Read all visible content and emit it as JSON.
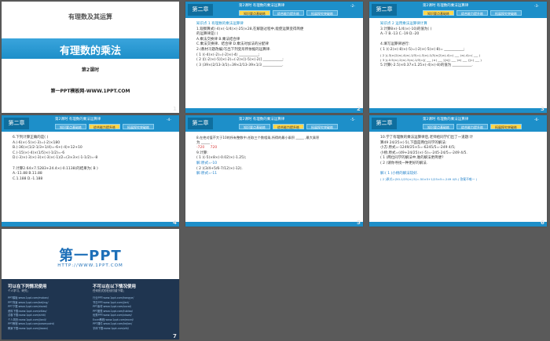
{
  "slides": {
    "s1": {
      "course": "有理数及其运算",
      "title": "有理数的乘法",
      "lesson": "第2课时",
      "footer": "第一PPT模板网-WWW.1PPT.COM",
      "num": "1"
    },
    "header": {
      "chapter": "第二章",
      "subtitle": "第2课时  有理数的乘法运算律",
      "tab1": "知识要点基础练",
      "tab2": "综合能力提升练",
      "tab3": "拓展探究突破练"
    },
    "s2": {
      "page": "-2-",
      "num": "2",
      "lines": [
        "知识点 1   有理数的乘法运算律",
        "1.观察算式(-4)×(-1/4)×(-25)×28,在解题过程中,能使运算变得简便",
        "的运算律是(      )",
        "A.乘法交换律                    B.乘法结合律",
        "C.乘法交换律、结合律        D.乘法对加法的分配律",
        "2.(教材习题改编)写出下列变形所依据的运算律.",
        "( 1 )(-4)×(-2)=(-2)×(-4) ___________;",
        "( 2 )[(-2)×(-5)]×(-2)=(-2)×[(-5)×(-2)] ___________;",
        "( 3 )39×(2/13-3/1)=39×2/13-39×1/3 ___________."
      ]
    },
    "s3": {
      "page": "-3-",
      "num": "3",
      "lines": [
        "知识点 2   运用乘法运算律计算",
        "3.计算8×(-1/4)×(-10)的值为(    )",
        "A.-7           B.-13           C.-19           D.-20",
        "",
        "4.填写运算律进行:",
        "( 1 )(-2)×(-8)×(-5)=(-2)×(-5)×(-8)= ___________;",
        "( 2 )(-3)×(2)×(-4)×(-1/3)=(-3)×(-1/3)×(2)×(-4)=( ___ )×(-4)=( ___ )",
        "( 3 )(-0.5)×(-2)×(-3)×(-1/3)=[( ___ )×( ___ )]×[( ___ )×( ___ )]=( ___ )",
        "5.计算(-2.5)×0.37×1.25×(-4)×(-8)的值为 ___________."
      ]
    },
    "s4": {
      "page": "-4-",
      "num": "4",
      "lines": [
        "6.下列计算正确的是(     )",
        "A.(-6)×(-5)×(-3)=(-2)×180",
        "B.(-36)×(1/2-1/3+1/4)=-6+(-4)+12+10",
        "C.(-15)×(-4)×(1/5)×(-1/2)=-6",
        "D.(-3)×(-3)×(-3)×(-3)×(-1)/2=(3×3×(-1-1/2)=-8",
        "",
        "7.计算2.64×7.5283+24.4×(-0.1138)的结果为(  B  )",
        "A.-11.88                    B.11.88",
        "C.1.188                     D.-1.188"
      ]
    },
    "s5": {
      "page": "-5-",
      "num": "5",
      "lines": [
        "8.在绝对值不大于10的所有整数中,任取三个数相乘,所得的最小乘积 _____ ,最大乘积",
        "为 _____ .",
        "9.计算:",
        "( 1 )(-5)×8×(-0.02)×(-1.25);",
        "解:原式=-10",
        "( 2 )(3/4+5/6-7/12)×(-12).",
        "解:原式=-11"
      ],
      "answers": [
        "-720",
        "720"
      ]
    },
    "s6": {
      "page": "-6-",
      "num": "6",
      "lines": [
        "10.学了有理数的乘法运算律后,老师给同学们出了一道题:计",
        "算49 24/25×(-5),下面是两位同学的解法:",
        "小方:原式=-1249/25×5=-6245/5=-249 4/5;",
        "小杨:原式=(49+24/25)×(-5)=-245-24/5=-249 4/5.",
        "( 1 )两位同学的解法中,谁的解法更简便?",
        "( 2 )请你寻找一种更好的解法.",
        "",
        "解:( 1 )小杨的解法较好.",
        "( 2 )原式=(50-1/25)×(-5)=-50×5+1/25×5=-249 4/5.( 答案不唯一 )"
      ]
    },
    "s7": {
      "logo": "第一PPT",
      "url": "HTTP://WWW.1PPT.COM",
      "num": "7",
      "can_title": "可以在下列情况使用",
      "can_sub": "个人学习、研究；",
      "cannot_title": "不可以在以下情况使用",
      "cannot_sub": "任何形式的在线付费下载；",
      "links_left": [
        "PPT模板:www.1ppt.com/moban/",
        "PPT背景:www.1ppt.com/beijing/",
        "PPT下载:www.1ppt.com/xiazai/",
        "资料下载:www.1ppt.com/ziliao/",
        "试卷下载:www.1ppt.com/shiti/",
        "个人简历:www.1ppt.com/jianli/",
        "PPT教程:www.1ppt.com/powerpoint/",
        "教案下载:www.1ppt.com/jiaoan/"
      ],
      "links_right": [
        "行业PPT:www.1ppt.com/hangye/",
        "节日PPT:www.1ppt.com/jieri/",
        "PPT素材:www.1ppt.com/sucai/",
        "PPT图表:www.1ppt.com/tubiao/",
        "优秀PPT:www.1ppt.com/xiazai/",
        "Excel教程:www.1ppt.com/excel/",
        "PPT课件:www.1ppt.com/kejian/",
        "字体下载:www.1ppt.com/ziti/"
      ]
    }
  }
}
